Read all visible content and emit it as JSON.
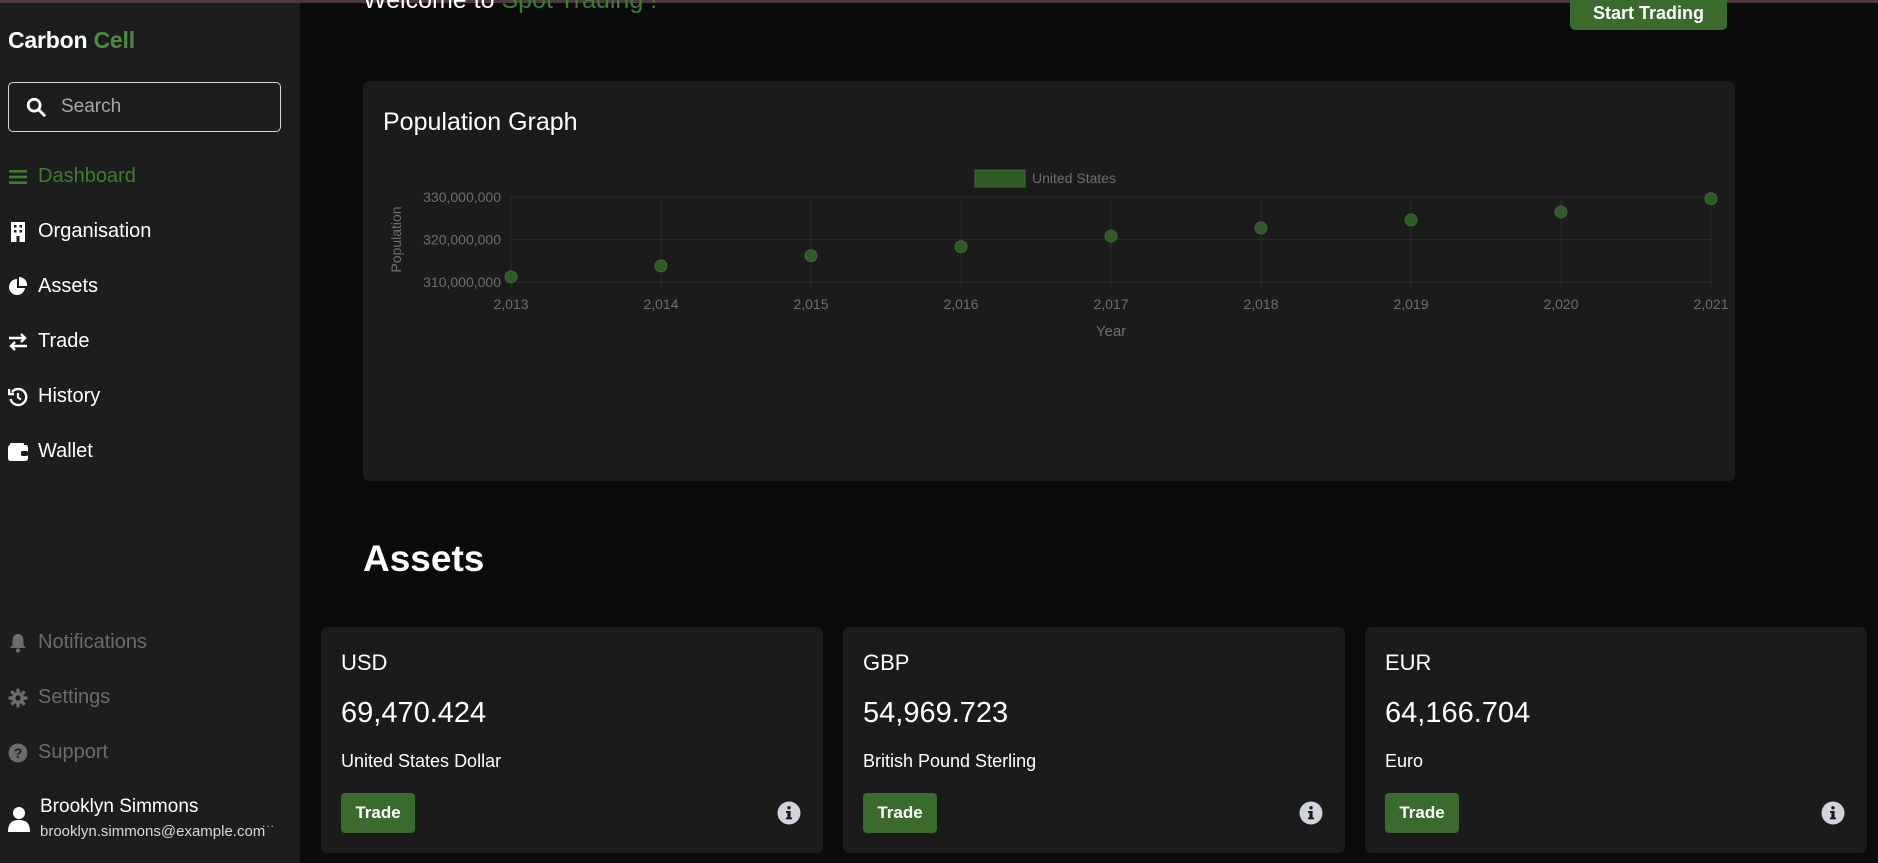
{
  "app": {
    "brand_primary": "Carbon",
    "brand_accent": "Cell",
    "accent_color": "#3f7d33"
  },
  "search": {
    "placeholder": "Search"
  },
  "sidebar": {
    "items": [
      {
        "label": "Dashboard",
        "icon": "menu-icon",
        "active": true
      },
      {
        "label": "Organisation",
        "icon": "building-icon"
      },
      {
        "label": "Assets",
        "icon": "pie-chart-icon"
      },
      {
        "label": "Trade",
        "icon": "exchange-icon"
      },
      {
        "label": "History",
        "icon": "history-icon"
      },
      {
        "label": "Wallet",
        "icon": "wallet-icon"
      }
    ],
    "bottom_items": [
      {
        "label": "Notifications",
        "icon": "bell-icon"
      },
      {
        "label": "Settings",
        "icon": "gear-icon"
      },
      {
        "label": "Support",
        "icon": "question-icon"
      }
    ]
  },
  "user": {
    "name": "Brooklyn Simmons",
    "email": "brooklyn.simmons@example.com",
    "more": "..."
  },
  "header": {
    "welcome_prefix": "Welcome to ",
    "welcome_accent": "Spot Trading !",
    "start_button": "Start Trading"
  },
  "graph": {
    "title": "Population Graph"
  },
  "chart_data": {
    "type": "scatter",
    "x": [
      2013,
      2014,
      2015,
      2016,
      2017,
      2018,
      2019,
      2020,
      2021
    ],
    "x_tick_labels": [
      "2,013",
      "2,014",
      "2,015",
      "2,016",
      "2,017",
      "2,018",
      "2,019",
      "2,020",
      "2,021"
    ],
    "series": [
      {
        "name": "United States",
        "values": [
          311200000,
          313800000,
          316200000,
          318300000,
          320800000,
          322700000,
          324600000,
          326500000,
          329600000
        ],
        "color": "#2f5a27"
      }
    ],
    "y_tick_values": [
      310000000,
      320000000,
      330000000
    ],
    "y_tick_labels": [
      "310,000,000",
      "320,000,000",
      "330,000,000"
    ],
    "ylim": [
      310000000,
      330000000
    ],
    "xlim": [
      2013,
      2021
    ],
    "xlabel": "Year",
    "ylabel": "Population",
    "legend": "top-center",
    "grid": true
  },
  "assets_section": {
    "title": "Assets",
    "cards": [
      {
        "code": "USD",
        "amount": "69,470.424",
        "name": "United States Dollar",
        "button": "Trade"
      },
      {
        "code": "GBP",
        "amount": "54,969.723",
        "name": "British Pound Sterling",
        "button": "Trade"
      },
      {
        "code": "EUR",
        "amount": "64,166.704",
        "name": "Euro",
        "button": "Trade"
      }
    ]
  }
}
